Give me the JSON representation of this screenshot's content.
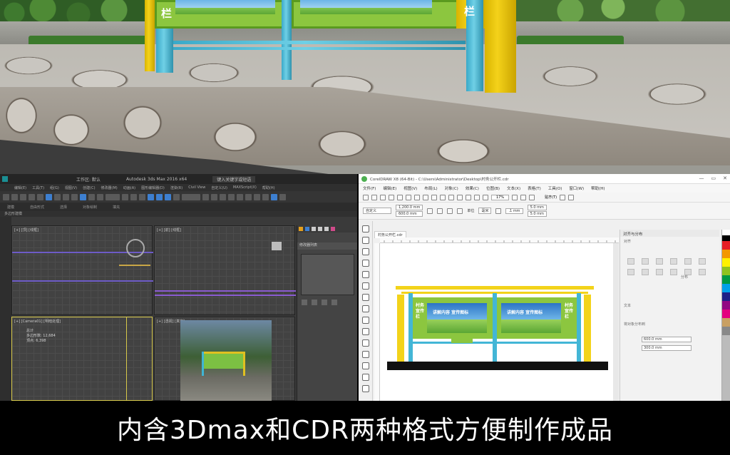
{
  "scene": {
    "billboard_chars": [
      "栏",
      "栏"
    ]
  },
  "max": {
    "title": "Autodesk 3ds Max 2016 x64",
    "workspace": "工作区: 默认",
    "search_placeholder": "键入关键字或短语",
    "menus": [
      "编辑(E)",
      "工具(T)",
      "组(G)",
      "视图(V)",
      "创建(C)",
      "修改器(M)",
      "动画(A)",
      "图形编辑器(D)",
      "渲染(R)",
      "Civil View",
      "自定义(U)",
      "MAXScript(X)",
      "帮助(H)"
    ],
    "ribbon_tabs": [
      "建模",
      "自由形式",
      "选择",
      "对象绘制",
      "填充"
    ],
    "subbar": "多边形建模",
    "viewports": [
      {
        "label": "[+] [顶] [线框]"
      },
      {
        "label": "[+] [前] [线框]"
      },
      {
        "label": "[+] [Camera01] [明暗处理]"
      },
      {
        "label": "[+] [透视] [真实]"
      }
    ],
    "stats": {
      "total": "总计",
      "polys": "多边形数: 12,684",
      "verts": "顶点: 6,398"
    },
    "cmd_header": "修改器列表"
  },
  "cdr": {
    "title": "CorelDRAW X8 (64-Bit) - C:\\Users\\Administrator\\Desktop\\村务公开栏.cdr",
    "menus": [
      "文件(F)",
      "编辑(E)",
      "视图(V)",
      "布局(L)",
      "对象(C)",
      "效果(C)",
      "位图(B)",
      "文本(X)",
      "表格(T)",
      "工具(O)",
      "窗口(W)",
      "帮助(H)"
    ],
    "zoom": "17%",
    "snap_label": "贴齐(T)",
    "preset": "自定义",
    "width_field": "1,200.0 mm",
    "height_field": "600.0 mm",
    "unit_label": "单位",
    "unit_value": "毫米",
    "nudge": ".1 mm",
    "dup1": "5.0 mm",
    "dup2": "5.0 mm",
    "doc_tab": "村务公开栏.cdr",
    "dock_title": "对齐与分布",
    "dock_align": "对齐",
    "dock_distribute": "分布",
    "dock_text": "文本",
    "dock_spacing": "将对象分布到",
    "field_w": "600.0 mm",
    "field_h": "300.0 mm",
    "panel_text_left": "讲解内容 宣传图标",
    "panel_text_right": "讲解内容 宣传图标",
    "side_text_left": "村务 宣传栏",
    "side_text_right": "村务 宣传栏"
  },
  "caption": "内含3Dmax和CDR两种格式方便制作成品"
}
